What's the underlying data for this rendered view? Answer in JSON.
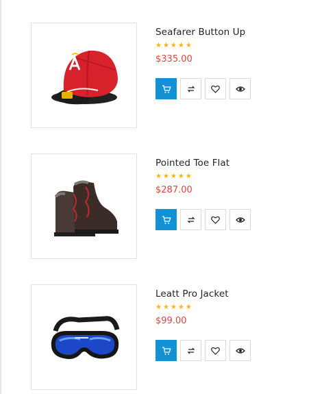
{
  "products": [
    {
      "title": "Seafarer Button Up",
      "price": "$335.00",
      "rating": 5,
      "stars": "★★★★★",
      "image": "red-baseball-cap"
    },
    {
      "title": "Pointed Toe Flat",
      "price": "$287.00",
      "rating": 5,
      "stars": "★★★★★",
      "image": "leather-hiking-boots"
    },
    {
      "title": "Leatt Pro Jacket",
      "price": "$99.00",
      "rating": 5,
      "stars": "★★★★★",
      "image": "blue-ski-goggles"
    }
  ],
  "actions": {
    "cart_icon": "cart-icon",
    "compare_icon": "compare-icon",
    "wishlist_icon": "heart-icon",
    "quickview_icon": "eye-icon"
  },
  "colors": {
    "accent": "#1292d4",
    "price": "#e0433e",
    "star": "#f6b60a",
    "border": "#e1e1e1"
  }
}
